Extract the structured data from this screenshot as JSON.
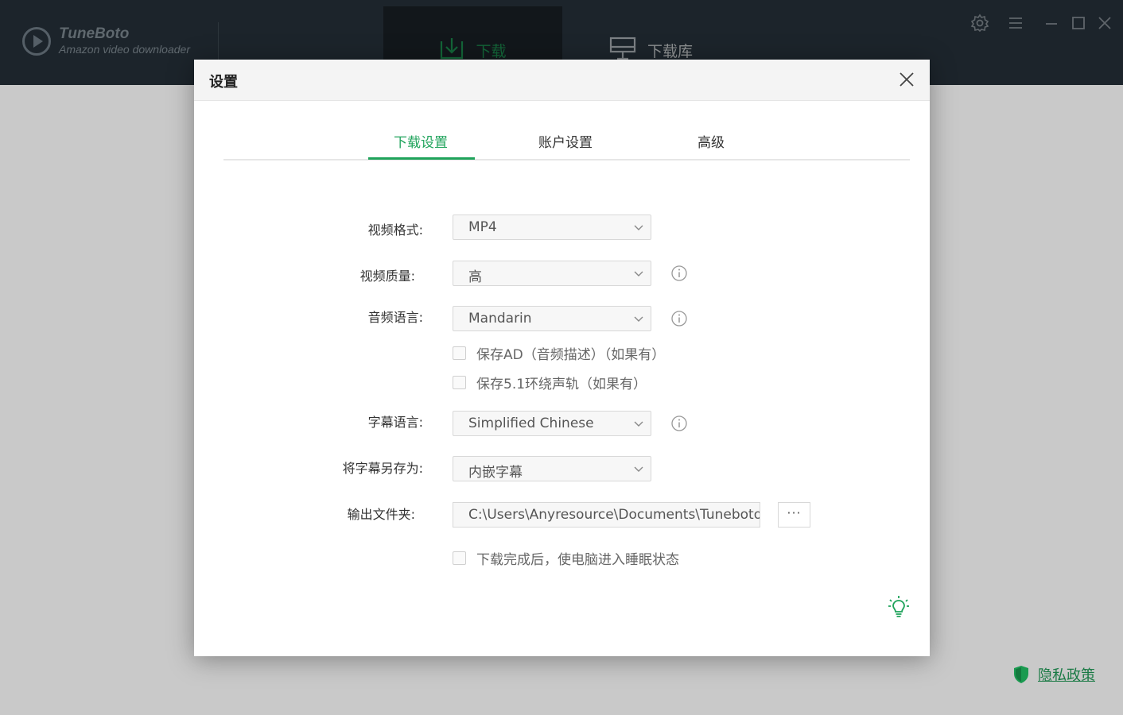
{
  "app": {
    "name": "TuneBoto",
    "subtitle": "Amazon video downloader",
    "nav": {
      "download": "下载",
      "library": "下载库"
    },
    "accent": "#1fa35b"
  },
  "dialog": {
    "title": "设置",
    "tabs": [
      "下载设置",
      "账户设置",
      "高级"
    ],
    "active_tab": "下载设置",
    "fields": {
      "video_format": {
        "label": "视频格式:",
        "value": "MP4"
      },
      "video_quality": {
        "label": "视频质量:",
        "value": "高"
      },
      "audio_language": {
        "label": "音频语言:",
        "value": "Mandarin"
      },
      "save_ad": "保存AD（音频描述）（如果有）",
      "save_51": "保存5.1环绕声轨（如果有）",
      "subtitle_language": {
        "label": "字幕语言:",
        "value": "Simplified Chinese"
      },
      "save_subtitle_as": {
        "label": "将字幕另存为:",
        "value": "内嵌字幕"
      },
      "output_folder": {
        "label": "输出文件夹:",
        "value": "C:\\Users\\Anyresource\\Documents\\Tuneboto",
        "browse": "···"
      },
      "sleep_after": "下载完成后，使电脑进入睡眠状态"
    }
  },
  "footer": {
    "privacy": "隐私政策"
  }
}
